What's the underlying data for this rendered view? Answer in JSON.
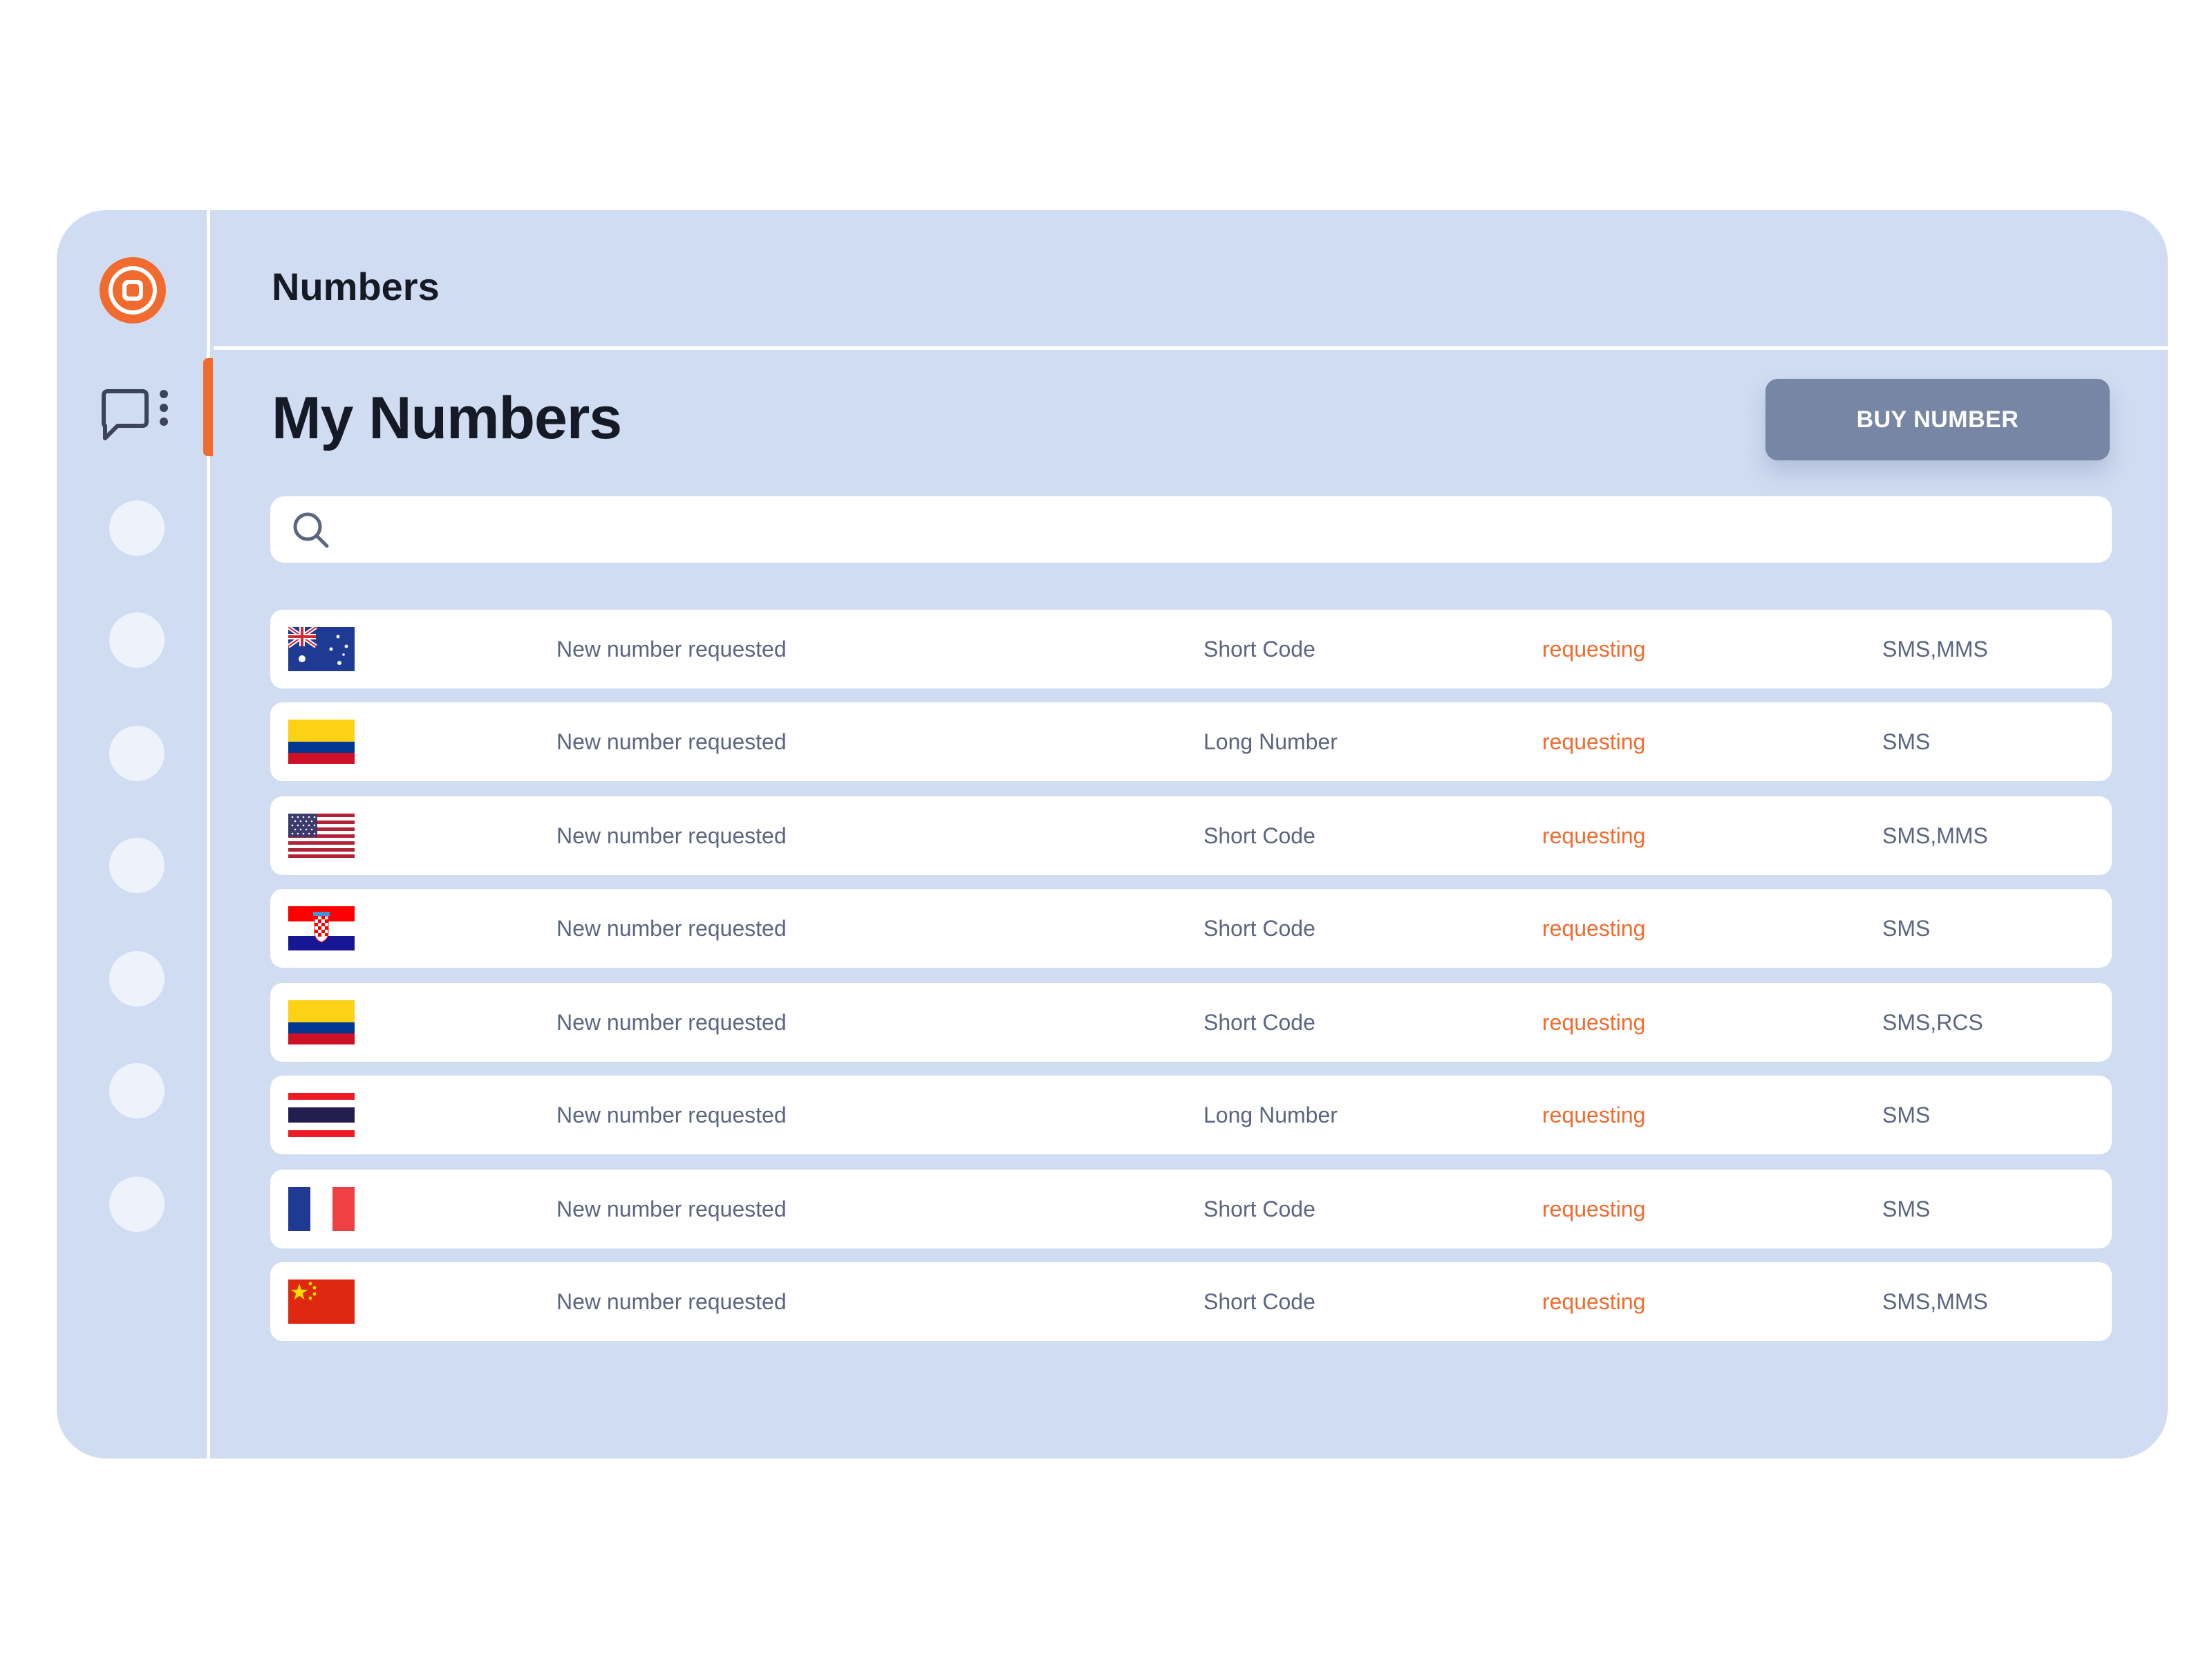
{
  "header": {
    "title": "Numbers"
  },
  "page": {
    "title": "My Numbers",
    "buy_label": "BUY NUMBER"
  },
  "search": {
    "placeholder": "",
    "value": ""
  },
  "colors": {
    "accent": "#f26b2e",
    "panel": "#d0dcf2",
    "button": "#7786a4"
  },
  "icons": {
    "logo": "target-logo-icon",
    "nav": "chat-menu-icon",
    "search": "search-icon"
  },
  "rows": [
    {
      "flag": "australia-flag-icon",
      "description": "New number requested",
      "type": "Short Code",
      "status": "requesting",
      "channels": "SMS,MMS"
    },
    {
      "flag": "colombia-flag-icon",
      "description": "New number requested",
      "type": "Long Number",
      "status": "requesting",
      "channels": "SMS"
    },
    {
      "flag": "usa-flag-icon",
      "description": "New number requested",
      "type": "Short Code",
      "status": "requesting",
      "channels": "SMS,MMS"
    },
    {
      "flag": "croatia-flag-icon",
      "description": "New number requested",
      "type": "Short Code",
      "status": "requesting",
      "channels": "SMS"
    },
    {
      "flag": "colombia-flag-icon",
      "description": "New number requested",
      "type": "Short Code",
      "status": "requesting",
      "channels": "SMS,RCS"
    },
    {
      "flag": "thailand-flag-icon",
      "description": "New number requested",
      "type": "Long Number",
      "status": "requesting",
      "channels": "SMS"
    },
    {
      "flag": "france-flag-icon",
      "description": "New number requested",
      "type": "Short Code",
      "status": "requesting",
      "channels": "SMS"
    },
    {
      "flag": "china-flag-icon",
      "description": "New number requested",
      "type": "Short Code",
      "status": "requesting",
      "channels": "SMS,MMS"
    }
  ]
}
